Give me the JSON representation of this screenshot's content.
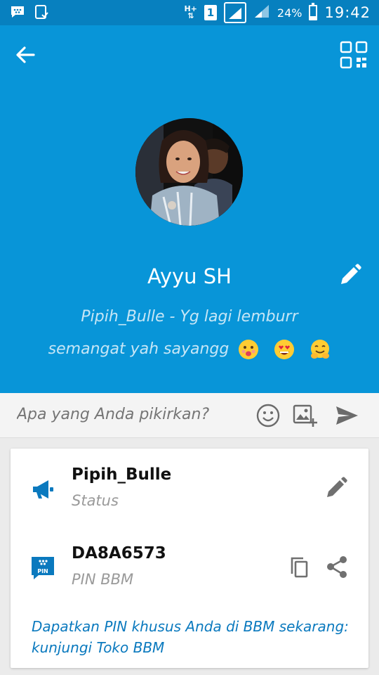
{
  "status_bar": {
    "network_type": "H+",
    "sim_slot": "1",
    "battery_percent": "24%",
    "battery_level": 0.24,
    "time": "19:42",
    "icons": [
      "bbm-notification-icon",
      "screenshot-icon",
      "data-arrows-icon",
      "signal-icon",
      "battery-icon"
    ]
  },
  "header": {
    "background_color": "#0895d8",
    "back_icon": "arrow-left-icon",
    "qr_icon": "qr-code-icon",
    "name": "Ayyu SH",
    "edit_icon": "pencil-icon",
    "status_line_1": "Pipih_Bulle - Yg lagi lemburr",
    "status_line_2": "semangat yah sayangg",
    "status_emojis": [
      "kiss-face-emoji",
      "heart-eyes-emoji",
      "hugging-face-emoji"
    ]
  },
  "compose": {
    "placeholder": "Apa yang Anda pikirkan?",
    "icons": [
      "smiley-icon",
      "add-photo-icon",
      "send-icon"
    ]
  },
  "card": {
    "status_row": {
      "title": "Pipih_Bulle",
      "subtitle": "Status",
      "icon": "megaphone-icon",
      "action_icon": "pencil-icon"
    },
    "pin_row": {
      "title": "DA8A6573",
      "subtitle": "PIN BBM",
      "icon": "bbm-pin-icon",
      "icon_label": "PIN",
      "action_icons": [
        "copy-icon",
        "share-icon"
      ]
    },
    "promo_text": "Dapatkan PIN khusus Anda di BBM sekarang: kunjungi Toko BBM"
  },
  "colors": {
    "status_bar": "#0780bf",
    "header": "#0895d8",
    "accent_blue": "#0a79be",
    "muted_status": "#c6e6f6"
  }
}
